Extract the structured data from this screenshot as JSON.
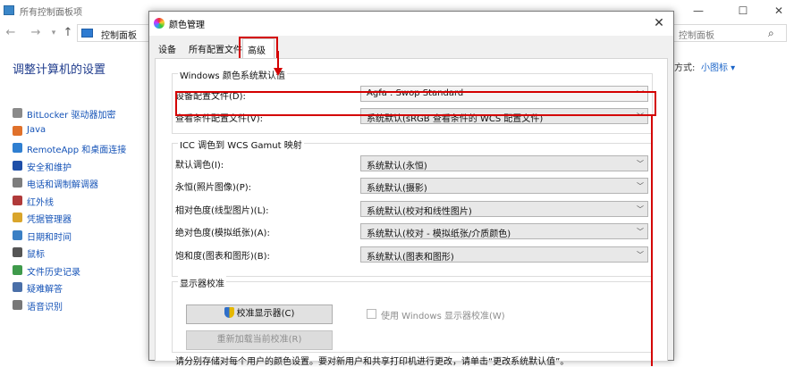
{
  "control_panel": {
    "title": "所有控制面板项",
    "breadcrumb": "控制面板",
    "search_placeholder": "控制面板",
    "heading": "调整计算机的设置",
    "view_by_label": "方式:",
    "view_by_value": "小图标 ▾",
    "items": [
      {
        "label": "BitLocker 驱动器加密",
        "icon": "bitlocker-icon"
      },
      {
        "label": "Java",
        "icon": "java-icon"
      },
      {
        "label": "RemoteApp 和桌面连接",
        "icon": "remoteapp-icon"
      },
      {
        "label": "安全和维护",
        "icon": "flag-icon"
      },
      {
        "label": "电话和调制解调器",
        "icon": "phone-icon"
      },
      {
        "label": "红外线",
        "icon": "infrared-icon"
      },
      {
        "label": "凭据管理器",
        "icon": "credential-icon"
      },
      {
        "label": "日期和时间",
        "icon": "clock-icon"
      },
      {
        "label": "鼠标",
        "icon": "mouse-icon"
      },
      {
        "label": "文件历史记录",
        "icon": "file-history-icon"
      },
      {
        "label": "疑难解答",
        "icon": "troubleshoot-icon"
      },
      {
        "label": "语音识别",
        "icon": "microphone-icon"
      }
    ]
  },
  "dialog": {
    "title": "颜色管理",
    "tabs": [
      "设备",
      "所有配置文件",
      "高级"
    ],
    "active_tab": "高级",
    "windows_group": {
      "title": "Windows 颜色系统默认值",
      "rows": [
        {
          "label": "设备配置文件(D):",
          "value": "Agfa : Swop Standard"
        },
        {
          "label": "查看条件配置文件(V):",
          "value": "系统默认(sRGB 查看条件的 WCS 配置文件)"
        }
      ]
    },
    "icc_group": {
      "title": "ICC 调色到 WCS Gamut 映射",
      "rows": [
        {
          "label": "默认调色(I):",
          "value": "系统默认(永恒)"
        },
        {
          "label": "永恒(照片图像)(P):",
          "value": "系统默认(摄影)"
        },
        {
          "label": "相对色度(线型图片)(L):",
          "value": "系统默认(校对和线性图片)"
        },
        {
          "label": "绝对色度(模拟纸张)(A):",
          "value": "系统默认(校对 - 模拟纸张/介质颜色)"
        },
        {
          "label": "饱和度(图表和图形)(B):",
          "value": "系统默认(图表和图形)"
        }
      ]
    },
    "calibration_group": {
      "title": "显示器校准",
      "calibrate_button": "校准显示器(C)",
      "reload_button": "重新加载当前校准(R)",
      "checkbox_label": "使用 Windows 显示器校准(W)",
      "checkbox_checked": false
    },
    "footer_text": "请分别存储对每个用户的颜色设置。要对新用户和共享打印机进行更改，请单击“更改系统默认值”。"
  },
  "colors": {
    "highlight_red": "#d40000",
    "link_blue": "#1553b7",
    "heading_blue": "#1e3b8c"
  }
}
